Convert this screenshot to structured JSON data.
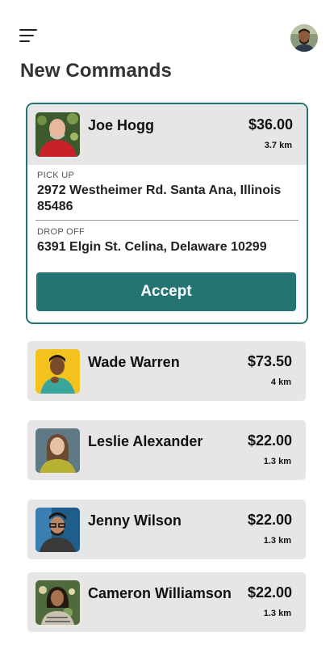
{
  "header": {
    "title": "New Commands"
  },
  "active": {
    "name": "Joe Hogg",
    "price": "$36.00",
    "distance": "3.7 km",
    "pickup_label": "PICK UP",
    "pickup_address": "2972 Westheimer Rd. Santa Ana, Illinois 85486",
    "dropoff_label": "DROP OFF",
    "dropoff_address": "6391 Elgin St. Celina, Delaware 10299",
    "accept_label": "Accept"
  },
  "commands": [
    {
      "name": "Wade Warren",
      "price": "$73.50",
      "distance": "4 km"
    },
    {
      "name": "Leslie Alexander",
      "price": "$22.00",
      "distance": "1.3 km"
    },
    {
      "name": "Jenny Wilson",
      "price": "$22.00",
      "distance": "1.3 km"
    },
    {
      "name": "Cameron Williamson",
      "price": "$22.00",
      "distance": "1.3 km"
    }
  ],
  "colors": {
    "accent": "#247474",
    "card_bg": "#e6e6e6"
  }
}
